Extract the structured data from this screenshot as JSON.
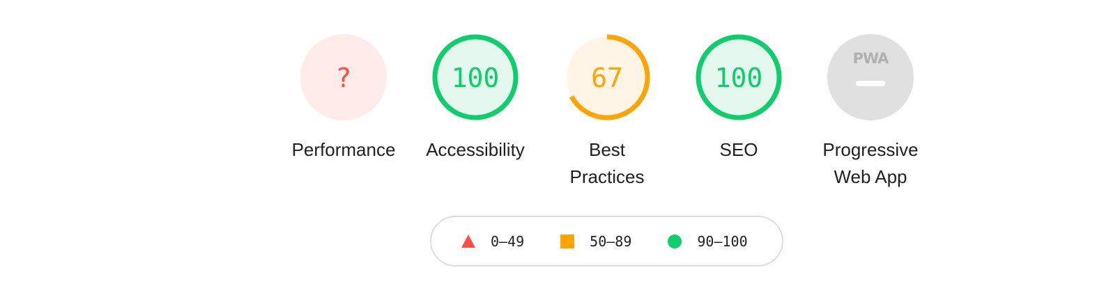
{
  "gauges": [
    {
      "id": "performance",
      "label": "Performance",
      "score": "?",
      "score_value": null,
      "rating": "error",
      "color": "#ff4e42",
      "fill": "#ffebe9"
    },
    {
      "id": "accessibility",
      "label": "Accessibility",
      "score": "100",
      "score_value": 100,
      "rating": "pass",
      "color": "#0cce6b",
      "fill": "#e5f8ee"
    },
    {
      "id": "best-practices",
      "label_line1": "Best",
      "label_line2": "Practices",
      "score": "67",
      "score_value": 67,
      "rating": "average",
      "color": "#ffa400",
      "fill": "#fff5e6"
    },
    {
      "id": "seo",
      "label": "SEO",
      "score": "100",
      "score_value": 100,
      "rating": "pass",
      "color": "#0cce6b",
      "fill": "#e5f8ee"
    },
    {
      "id": "pwa",
      "label_line1": "Progressive",
      "label_line2": "Web App",
      "badge_text": "PWA",
      "rating": "not-applicable",
      "color": "#b0b0b0",
      "fill": "#e0e0e0"
    }
  ],
  "legend": [
    {
      "shape": "triangle",
      "range": "0–49",
      "color": "#ff4e42"
    },
    {
      "shape": "square",
      "range": "50–89",
      "color": "#ffa400"
    },
    {
      "shape": "circle",
      "range": "90–100",
      "color": "#0cce6b"
    }
  ]
}
